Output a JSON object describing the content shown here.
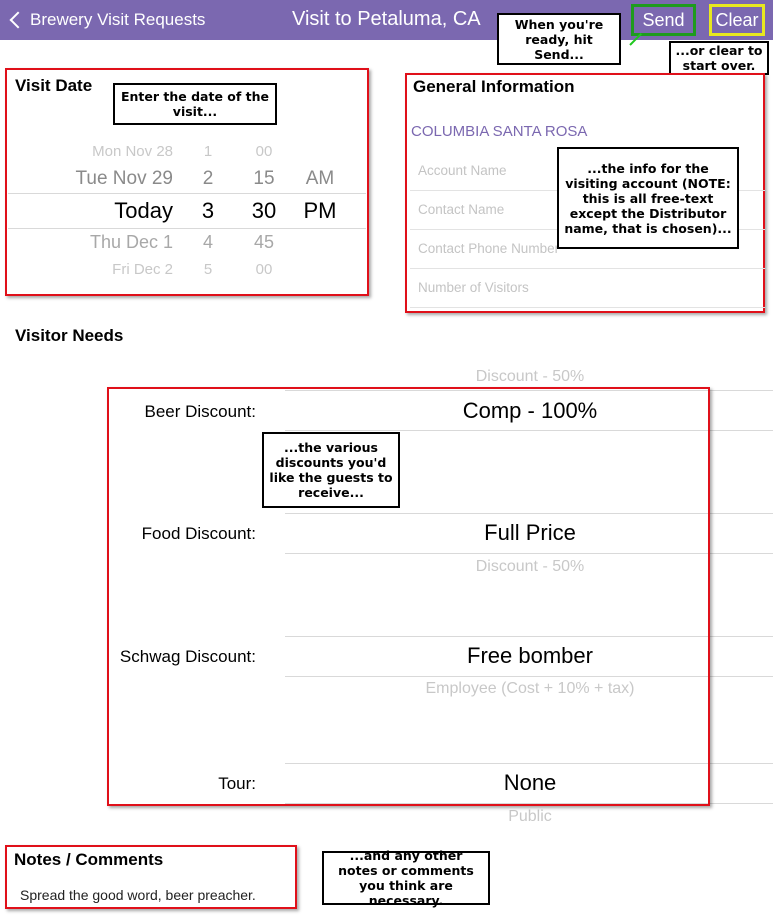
{
  "nav": {
    "back_label": "Brewery Visit Requests",
    "title": "Visit to Petaluma, CA",
    "send_label": "Send",
    "clear_label": "Clear"
  },
  "callouts": {
    "send": "When you're ready, hit Send...",
    "clear": "...or clear to start over.",
    "date": "Enter the date of the visit...",
    "info": "...the info for the visiting account (NOTE: this is all free-text except the Distributor name, that is chosen)...",
    "discounts": "...the various discounts you'd like the guests to receive...",
    "notes": "...and any other notes or comments you think are necessary."
  },
  "visit_date": {
    "title": "Visit Date",
    "rows": [
      {
        "day": "Mon Nov 28",
        "hour": "1",
        "min": "00",
        "ampm": ""
      },
      {
        "day": "Tue Nov 29",
        "hour": "2",
        "min": "15",
        "ampm": "AM"
      },
      {
        "day": "Today",
        "hour": "3",
        "min": "30",
        "ampm": "PM"
      },
      {
        "day": "Thu Dec 1",
        "hour": "4",
        "min": "45",
        "ampm": ""
      },
      {
        "day": "Fri Dec 2",
        "hour": "5",
        "min": "00",
        "ampm": ""
      }
    ]
  },
  "general_info": {
    "title": "General Information",
    "distributor": "COLUMBIA SANTA ROSA",
    "fields": [
      "Account Name",
      "Contact Name",
      "Contact Phone Number",
      "Number of Visitors"
    ]
  },
  "visitor_needs": {
    "title": "Visitor Needs",
    "beer": {
      "label": "Beer Discount:",
      "above": "Discount - 50%",
      "value": "Comp - 100%"
    },
    "food": {
      "label": "Food Discount:",
      "value": "Full Price",
      "below": "Discount - 50%"
    },
    "schwag": {
      "label": "Schwag Discount:",
      "value": "Free bomber",
      "below": "Employee (Cost + 10% + tax)"
    },
    "tour": {
      "label": "Tour:",
      "value": "None",
      "below": "Public"
    }
  },
  "notes": {
    "title": "Notes / Comments",
    "text": "Spread the good word, beer preacher."
  },
  "colors": {
    "nav_bar": "#7b68b0",
    "annotation_red": "#e0101a",
    "send_outline": "#1e9b1e",
    "clear_outline": "#e8e820"
  }
}
